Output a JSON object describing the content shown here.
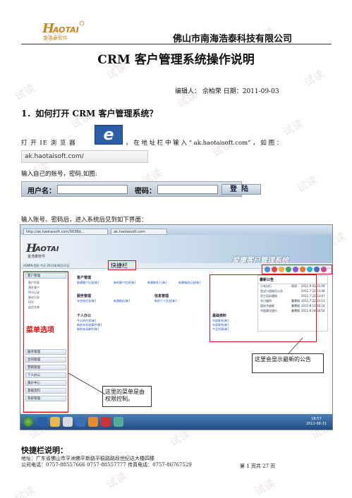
{
  "header": {
    "company": "佛山市南海浩泰科技有限公司",
    "logo_text": "HAOTAI",
    "logo_sub": "金浩泰软件"
  },
  "doc": {
    "title": "CRM 客户管理系统操作说明",
    "meta": "编辑人：  佘柏荣  日期：2011-09-03",
    "section1": "1．如何打开 CRM 客户管理系统？",
    "step_open_ie_1": "打 开 IE 浏 览 器",
    "step_open_ie_2": "， 在 地 址 栏 中 输 入 “ ak.haotaisoft.com” ， 如 图 ：",
    "url_example": "ak.haotaisoft.com/",
    "login_intro": "输入自己的账号，密码,如图:",
    "login_after": "输入账号、密码后，进入系统后见到如下界面：",
    "section2": "快捷栏说明："
  },
  "login_form": {
    "user_label": "用户名：",
    "pass_label": "密码：",
    "submit_label": "登陆"
  },
  "screenshot": {
    "tab1": "http://ak.haotaisoft.com/5636d...",
    "tab2": "ak.haotaisoft.com",
    "banner_title": "爱康客户管理系统",
    "status": "ADMIN 您好 今天 2011年08月31日",
    "menu_items": [
      "客户管理",
      "服务管理",
      "合同管理",
      "营销管理",
      "个人办公",
      "报价中心",
      "基础资料",
      "系统管理"
    ],
    "sub_items": [
      "客户列表",
      "潜在客户",
      "拜访记录",
      "跟进记录",
      "VOC",
      "退货名单"
    ],
    "sections": [
      "客户管理",
      "服务管理",
      "信息管理",
      "个人办公",
      "基础资料"
    ],
    "links": [
      "新建客户记录[新]",
      "新的客户信息[新]",
      "新建联系人[新]",
      "新建服务记录[新]",
      "未完成任务[新]",
      "新建报价[新]",
      "新的个人任务[新]",
      "今天的任务[新]",
      "新的未完成事件[新]",
      "新的未读邮件[新]",
      "内部联系[新]",
      "外部联系[新]",
      "产品列表[新]"
    ],
    "notice_title": "最新公告",
    "notices": [
      {
        "title": "小年出行",
        "who": "周滨",
        "date": "2011-9-01 15:09"
      },
      {
        "title": "会议小组成员公告",
        "who": "",
        "date": "2011-7-22 13:48"
      },
      {
        "title": "员工培训通知",
        "who": "",
        "date": "2011-7-22 13:47"
      },
      {
        "title": "节日福利",
        "who": "曹鹰钢",
        "date": "2011-7-22 10:13"
      },
      {
        "title": "国庆节放假",
        "who": "曹鹰钢",
        "date": "2011-6-11 16:24"
      },
      {
        "title": "中国建设银行",
        "who": "曹鹰钢",
        "date": "2011-6-18 18:54"
      }
    ],
    "clock_time": "18:57",
    "clock_date": "2011-08-31"
  },
  "annotations": {
    "shortcut_label": "快捷栏",
    "menu_label": "菜单选项",
    "menu_note": "这里的菜单是由权限控制。",
    "notice_note": "这里会显示最新的公告"
  },
  "footer": {
    "address": "地址：广东省佛山市平洲佛平新路平稳路路段世纪达大楼四楼",
    "phone": "公司电话：0757-88557666  0757-88557777  传真电话：0757-86767529",
    "page": "第 1 页共 27 页"
  },
  "watermark": "试读",
  "colors": {
    "accent_red": "#e01010",
    "link_blue": "#1a4fb5",
    "taskbar": "#1d4a80"
  }
}
